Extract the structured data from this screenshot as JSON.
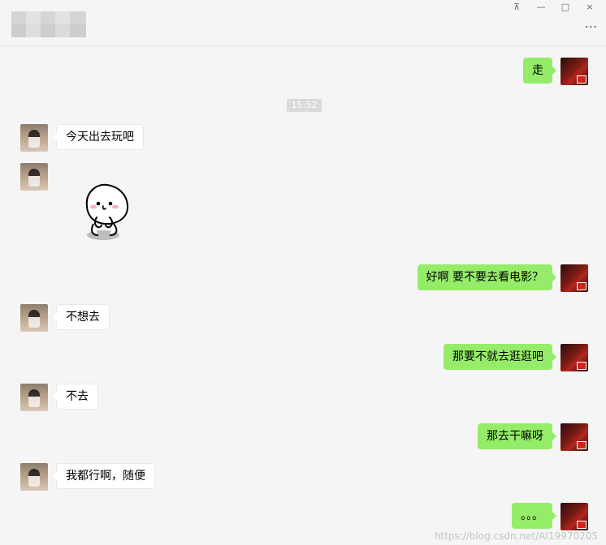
{
  "window": {
    "controls": {
      "pin": "⊼",
      "minimize": "—",
      "maximize": "□",
      "close": "×"
    },
    "more": "⋯"
  },
  "chat": {
    "timestamp": "15:52",
    "messages": [
      {
        "side": "right",
        "text": "走"
      },
      {
        "side": "left",
        "text": "今天出去玩吧"
      },
      {
        "side": "left",
        "type": "sticker",
        "text": ""
      },
      {
        "side": "right",
        "text": "好啊 要不要去看电影？"
      },
      {
        "side": "left",
        "text": "不想去"
      },
      {
        "side": "right",
        "text": "那要不就去逛逛吧"
      },
      {
        "side": "left",
        "text": "不去"
      },
      {
        "side": "right",
        "text": "那去干嘛呀"
      },
      {
        "side": "left",
        "text": "我都行啊，随便"
      },
      {
        "side": "right",
        "text": "。。。"
      }
    ]
  },
  "watermark": "https://blog.csdn.net/AI19970205",
  "colors": {
    "background": "#f5f5f5",
    "my_bubble": "#95ec69",
    "friend_bubble": "#ffffff",
    "timestamp_bg": "#dadada"
  },
  "icons": {
    "my_avatar": "my-avatar",
    "friend_avatar": "friend-avatar",
    "sticker": "sticker-icon"
  }
}
